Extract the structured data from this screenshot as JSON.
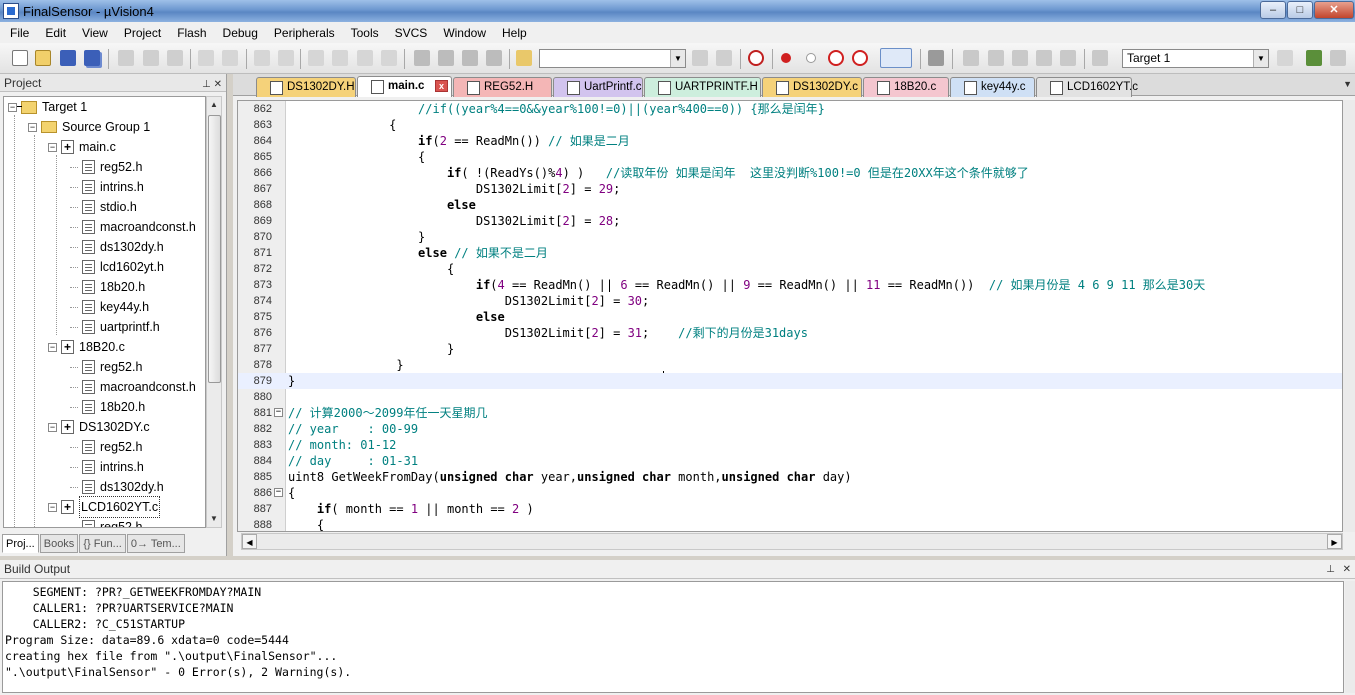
{
  "window": {
    "title": "FinalSensor - µVision4",
    "min": "–",
    "max": "□",
    "close": "✕"
  },
  "menu": [
    "File",
    "Edit",
    "View",
    "Project",
    "Flash",
    "Debug",
    "Peripherals",
    "Tools",
    "SVCS",
    "Window",
    "Help"
  ],
  "toolbar": {
    "target": "Target 1",
    "find_value": ""
  },
  "project": {
    "title": "Project",
    "tree": [
      {
        "label": "Target 1",
        "kind": "target",
        "level": 0
      },
      {
        "label": "Source Group 1",
        "kind": "folder",
        "level": 1
      },
      {
        "label": "main.c",
        "kind": "c",
        "level": 2
      },
      {
        "label": "reg52.h",
        "kind": "h",
        "level": 3
      },
      {
        "label": "intrins.h",
        "kind": "h",
        "level": 3
      },
      {
        "label": "stdio.h",
        "kind": "h",
        "level": 3
      },
      {
        "label": "macroandconst.h",
        "kind": "h",
        "level": 3
      },
      {
        "label": "ds1302dy.h",
        "kind": "h",
        "level": 3
      },
      {
        "label": "lcd1602yt.h",
        "kind": "h",
        "level": 3
      },
      {
        "label": "18b20.h",
        "kind": "h",
        "level": 3
      },
      {
        "label": "key44y.h",
        "kind": "h",
        "level": 3
      },
      {
        "label": "uartprintf.h",
        "kind": "h",
        "level": 3
      },
      {
        "label": "18B20.c",
        "kind": "c",
        "level": 2
      },
      {
        "label": "reg52.h",
        "kind": "h",
        "level": 3
      },
      {
        "label": "macroandconst.h",
        "kind": "h",
        "level": 3
      },
      {
        "label": "18b20.h",
        "kind": "h",
        "level": 3
      },
      {
        "label": "DS1302DY.c",
        "kind": "c",
        "level": 2
      },
      {
        "label": "reg52.h",
        "kind": "h",
        "level": 3
      },
      {
        "label": "intrins.h",
        "kind": "h",
        "level": 3
      },
      {
        "label": "ds1302dy.h",
        "kind": "h",
        "level": 3
      },
      {
        "label": "LCD1602YT.c",
        "kind": "c",
        "level": 2
      },
      {
        "label": "reg52.h",
        "kind": "h",
        "level": 3
      }
    ],
    "tabs": [
      "Proj...",
      "Books",
      "{} Fun...",
      "0→ Tem..."
    ]
  },
  "editor": {
    "tabs": [
      {
        "label": "DS1302DY.H",
        "color": "#f5d27a"
      },
      {
        "label": "main.c",
        "color": "#ffffff",
        "active": true
      },
      {
        "label": "REG52.H",
        "color": "#f4b6b6"
      },
      {
        "label": "UartPrintf.c",
        "color": "#d2c4ee"
      },
      {
        "label": "UARTPRINTF.H",
        "color": "#cdeedd"
      },
      {
        "label": "DS1302DY.c",
        "color": "#f5d27a"
      },
      {
        "label": "18B20.c",
        "color": "#f4c6cf"
      },
      {
        "label": "key44y.c",
        "color": "#cfe0f5"
      },
      {
        "label": "LCD1602YT.c",
        "color": "#e2e2e2"
      }
    ],
    "lines": [
      {
        "n": "862",
        "fold": "",
        "segs": [
          [
            "",
            "                  "
          ],
          [
            "cm",
            "//if((year%4==0&&year%100!=0)||(year%400==0)) {那么是闰年}"
          ]
        ]
      },
      {
        "n": "863",
        "fold": "",
        "segs": [
          [
            "",
            "              {"
          ]
        ]
      },
      {
        "n": "864",
        "fold": "",
        "segs": [
          [
            "",
            "                  "
          ],
          [
            "kw",
            "if"
          ],
          [
            "",
            "("
          ],
          [
            "num",
            "2"
          ],
          [
            "",
            " == ReadMn()) "
          ],
          [
            "cm",
            "// 如果是二月"
          ]
        ]
      },
      {
        "n": "865",
        "fold": "",
        "segs": [
          [
            "",
            "                  {"
          ]
        ]
      },
      {
        "n": "866",
        "fold": "",
        "segs": [
          [
            "",
            "                      "
          ],
          [
            "kw",
            "if"
          ],
          [
            "",
            "( !(ReadYs()%"
          ],
          [
            "num",
            "4"
          ],
          [
            "",
            ") )   "
          ],
          [
            "cm",
            "//读取年份 如果是闰年  这里没判断%100!=0 但是在20XX年这个条件就够了"
          ]
        ]
      },
      {
        "n": "867",
        "fold": "",
        "segs": [
          [
            "",
            "                          DS1302Limit["
          ],
          [
            "num",
            "2"
          ],
          [
            "",
            "] = "
          ],
          [
            "num",
            "29"
          ],
          [
            "",
            ";"
          ]
        ]
      },
      {
        "n": "868",
        "fold": "",
        "segs": [
          [
            "",
            "                      "
          ],
          [
            "kw",
            "else"
          ]
        ]
      },
      {
        "n": "869",
        "fold": "",
        "segs": [
          [
            "",
            "                          DS1302Limit["
          ],
          [
            "num",
            "2"
          ],
          [
            "",
            "] = "
          ],
          [
            "num",
            "28"
          ],
          [
            "",
            ";"
          ]
        ]
      },
      {
        "n": "870",
        "fold": "",
        "segs": [
          [
            "",
            "                  }"
          ]
        ]
      },
      {
        "n": "871",
        "fold": "",
        "segs": [
          [
            "",
            "                  "
          ],
          [
            "kw",
            "else"
          ],
          [
            "",
            " "
          ],
          [
            "cm",
            "// 如果不是二月"
          ]
        ]
      },
      {
        "n": "872",
        "fold": "",
        "segs": [
          [
            "",
            "                      {"
          ]
        ]
      },
      {
        "n": "873",
        "fold": "",
        "segs": [
          [
            "",
            "                          "
          ],
          [
            "kw",
            "if"
          ],
          [
            "",
            "("
          ],
          [
            "num",
            "4"
          ],
          [
            "",
            " == ReadMn() || "
          ],
          [
            "num",
            "6"
          ],
          [
            "",
            " == ReadMn() || "
          ],
          [
            "num",
            "9"
          ],
          [
            "",
            " == ReadMn() || "
          ],
          [
            "num",
            "11"
          ],
          [
            "",
            " == ReadMn())  "
          ],
          [
            "cm",
            "// 如果月份是 4 6 9 11 那么是30天"
          ]
        ]
      },
      {
        "n": "874",
        "fold": "",
        "segs": [
          [
            "",
            "                              DS1302Limit["
          ],
          [
            "num",
            "2"
          ],
          [
            "",
            "] = "
          ],
          [
            "num",
            "30"
          ],
          [
            "",
            ";"
          ]
        ]
      },
      {
        "n": "875",
        "fold": "",
        "segs": [
          [
            "",
            "                          "
          ],
          [
            "kw",
            "else"
          ]
        ]
      },
      {
        "n": "876",
        "fold": "",
        "segs": [
          [
            "",
            "                              DS1302Limit["
          ],
          [
            "num",
            "2"
          ],
          [
            "",
            "] = "
          ],
          [
            "num",
            "31"
          ],
          [
            "",
            ";    "
          ],
          [
            "cm",
            "//剩下的月份是31days"
          ]
        ]
      },
      {
        "n": "877",
        "fold": "",
        "segs": [
          [
            "",
            "                      }"
          ]
        ]
      },
      {
        "n": "878",
        "fold": "",
        "segs": [
          [
            "",
            "               }"
          ]
        ]
      },
      {
        "n": "879",
        "fold": "",
        "hl": true,
        "segs": [
          [
            "",
            "}"
          ]
        ]
      },
      {
        "n": "880",
        "fold": "",
        "segs": [
          [
            "",
            ""
          ]
        ]
      },
      {
        "n": "881",
        "fold": "−",
        "segs": [
          [
            "cm",
            "// 计算2000～2099年任一天星期几"
          ]
        ]
      },
      {
        "n": "882",
        "fold": "",
        "segs": [
          [
            "cm",
            "// year    : 00-99"
          ]
        ]
      },
      {
        "n": "883",
        "fold": "",
        "segs": [
          [
            "cm",
            "// month: 01-12"
          ]
        ]
      },
      {
        "n": "884",
        "fold": "",
        "segs": [
          [
            "cm",
            "// day     : 01-31"
          ]
        ]
      },
      {
        "n": "885",
        "fold": "",
        "segs": [
          [
            "",
            "uint8 GetWeekFromDay("
          ],
          [
            "kw",
            "unsigned"
          ],
          [
            "",
            " "
          ],
          [
            "kw",
            "char"
          ],
          [
            "",
            " year,"
          ],
          [
            "kw",
            "unsigned"
          ],
          [
            "",
            " "
          ],
          [
            "kw",
            "char"
          ],
          [
            "",
            " month,"
          ],
          [
            "kw",
            "unsigned"
          ],
          [
            "",
            " "
          ],
          [
            "kw",
            "char"
          ],
          [
            "",
            " day)"
          ]
        ]
      },
      {
        "n": "886",
        "fold": "−",
        "segs": [
          [
            "",
            "{"
          ]
        ]
      },
      {
        "n": "887",
        "fold": "",
        "segs": [
          [
            "",
            "    "
          ],
          [
            "kw",
            "if"
          ],
          [
            "",
            "( month == "
          ],
          [
            "num",
            "1"
          ],
          [
            "",
            " || month == "
          ],
          [
            "num",
            "2"
          ],
          [
            "",
            " )"
          ]
        ]
      },
      {
        "n": "888",
        "fold": "",
        "segs": [
          [
            "",
            "    {"
          ]
        ]
      }
    ]
  },
  "build": {
    "title": "Build Output",
    "lines": [
      "    SEGMENT: ?PR?_GETWEEKFROMDAY?MAIN",
      "    CALLER1: ?PR?UARTSERVICE?MAIN",
      "    CALLER2: ?C_C51STARTUP",
      "Program Size: data=89.6 xdata=0 code=5444",
      "creating hex file from \".\\output\\FinalSensor\"...",
      "\".\\output\\FinalSensor\" - 0 Error(s), 2 Warning(s)."
    ]
  }
}
